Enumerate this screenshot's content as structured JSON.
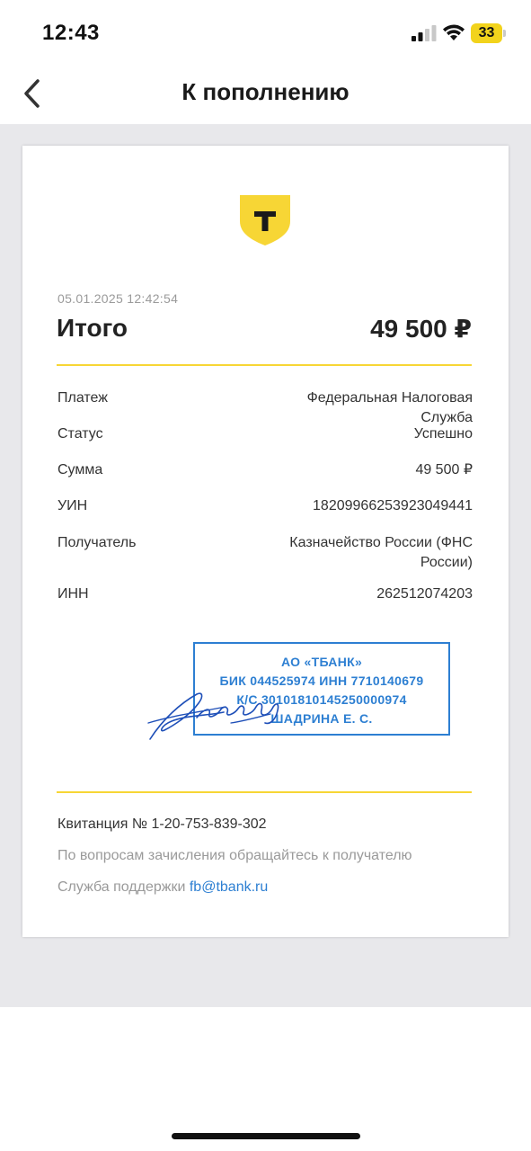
{
  "status_bar": {
    "time": "12:43",
    "battery": "33",
    "icons": [
      "signal-icon",
      "wifi-icon",
      "battery-icon"
    ]
  },
  "nav": {
    "title": "К пополнению",
    "back_icon": "chevron-left-icon"
  },
  "receipt": {
    "logo_icon": "tbank-shield-logo",
    "datetime": "05.01.2025  12:42:54",
    "total_label": "Итого",
    "total_amount": "49 500 ₽",
    "rows": [
      {
        "label": "Платеж",
        "value": "Федеральная Налоговая Служба"
      },
      {
        "label": "Статус",
        "value": "Успешно"
      },
      {
        "label": "Сумма",
        "value": "49 500 ₽"
      },
      {
        "label": "УИН",
        "value": "18209966253923049441"
      },
      {
        "label": "Получатель",
        "value": "Казначейство России (ФНС России)"
      },
      {
        "label": "ИНН",
        "value": "262512074203"
      }
    ],
    "stamp": {
      "lines": [
        "АО «ТБАНК»",
        "БИК 044525974 ИНН 7710140679",
        "К/С 30101810145250000974",
        "ШАДРИНА Е. С."
      ]
    },
    "receipt_number": "Квитанция  № 1-20-753-839-302",
    "note": "По вопросам зачисления обращайтесь к получателю",
    "support_label": "Служба поддержки ",
    "support_email": "fb@tbank.ru"
  },
  "colors": {
    "accent_yellow": "#f7d635",
    "stamp_blue": "#2d7fd2",
    "background_gray": "#e8e8eb"
  }
}
